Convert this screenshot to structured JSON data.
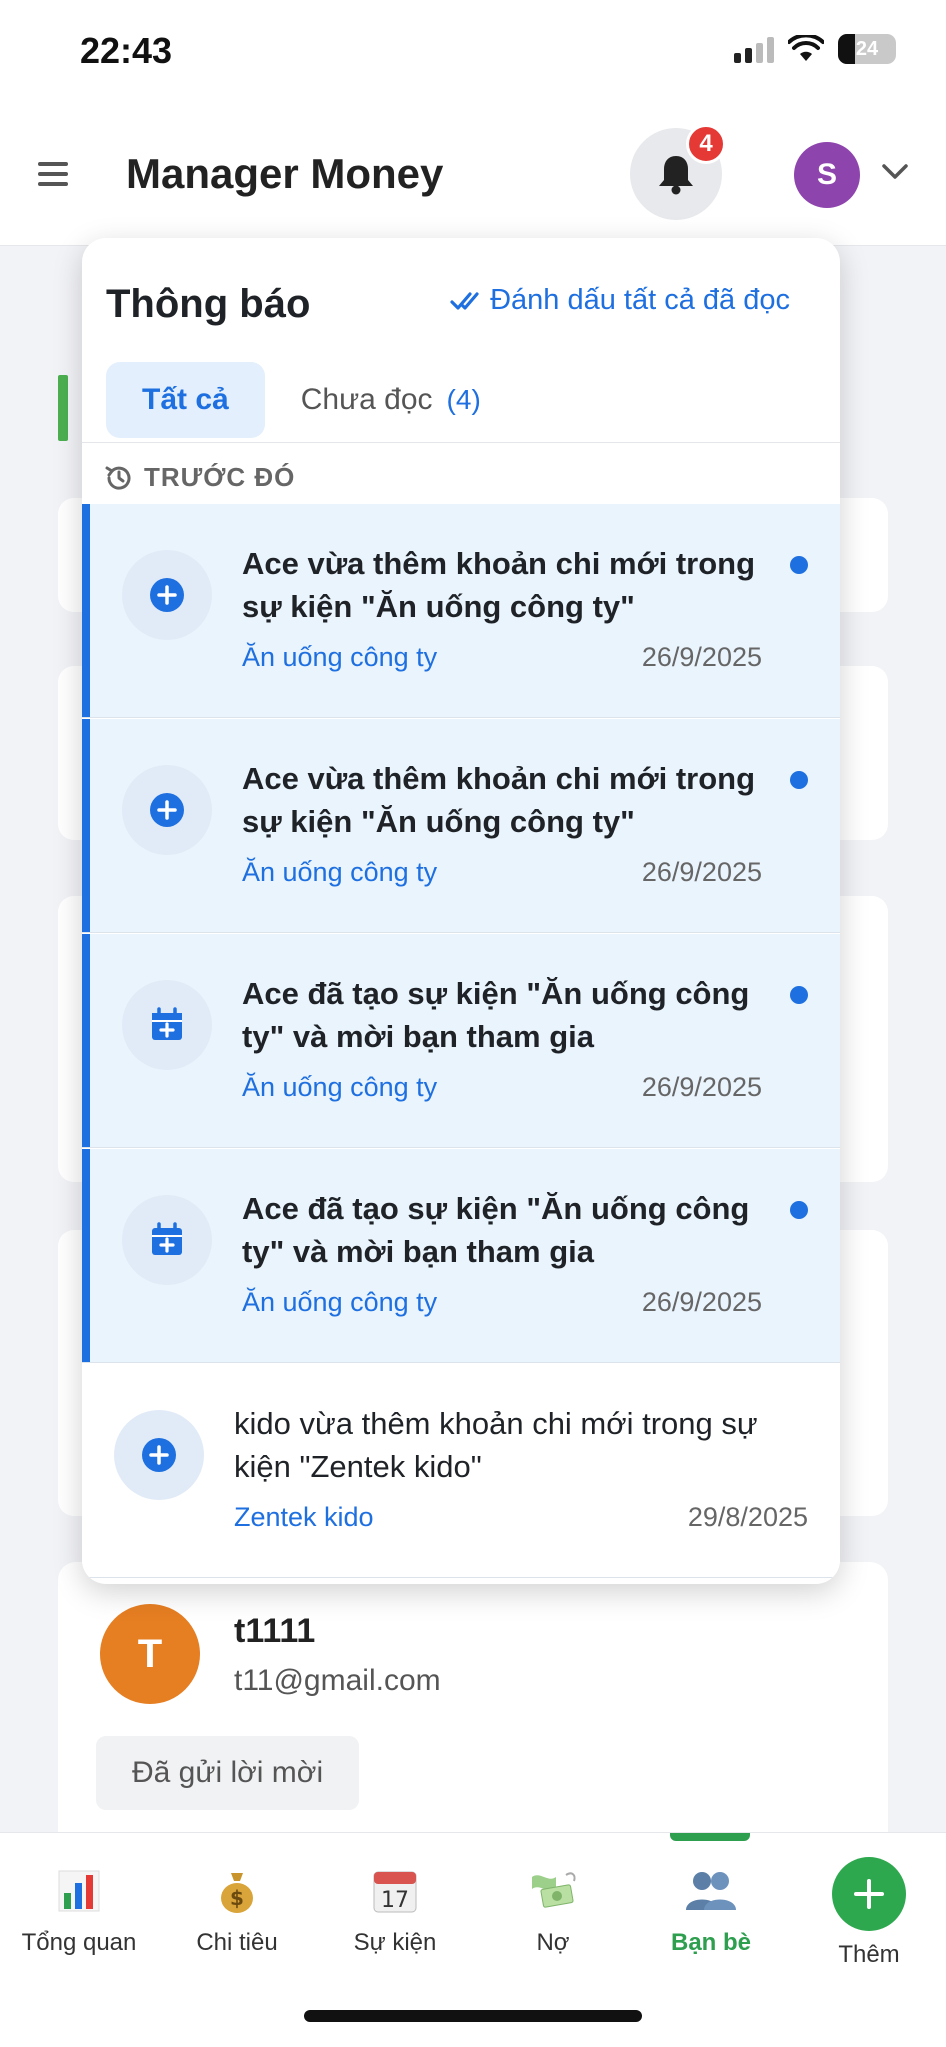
{
  "status_bar": {
    "time": "22:43",
    "battery": "24"
  },
  "header": {
    "title": "Manager Money",
    "notification_count": "4",
    "avatar_initial": "S"
  },
  "notifications_panel": {
    "title": "Thông báo",
    "mark_all_read": "Đánh dấu tất cả đã đọc",
    "tabs": {
      "all": "Tất cả",
      "unread": "Chưa đọc",
      "unread_count": "(4)"
    },
    "section_label": "TRƯỚC ĐÓ",
    "items": [
      {
        "text": "Ace vừa thêm khoản chi mới trong sự kiện \"Ăn uống công ty\"",
        "event": "Ăn uống công ty",
        "date": "26/9/2025",
        "icon": "plus-circle-icon",
        "unread": true
      },
      {
        "text": "Ace vừa thêm khoản chi mới trong sự kiện \"Ăn uống công ty\"",
        "event": "Ăn uống công ty",
        "date": "26/9/2025",
        "icon": "plus-circle-icon",
        "unread": true
      },
      {
        "text": "Ace đã tạo sự kiện \"Ăn uống công ty\" và mời bạn tham gia",
        "event": "Ăn uống công ty",
        "date": "26/9/2025",
        "icon": "calendar-plus-icon",
        "unread": true
      },
      {
        "text": "Ace đã tạo sự kiện \"Ăn uống công ty\" và mời bạn tham gia",
        "event": "Ăn uống công ty",
        "date": "26/9/2025",
        "icon": "calendar-plus-icon",
        "unread": true
      },
      {
        "text": "kido vừa thêm khoản chi mới trong sự kiện \"Zentek kido\"",
        "event": "Zentek kido",
        "date": "29/8/2025",
        "icon": "plus-circle-icon",
        "unread": false
      }
    ]
  },
  "friend_card": {
    "initial": "T",
    "name": "t1111",
    "email": "t11@gmail.com",
    "status_button": "Đã gửi lời mời"
  },
  "bottom_nav": {
    "items": [
      {
        "label": "Tổng quan",
        "icon": "bar-chart-icon"
      },
      {
        "label": "Chi tiêu",
        "icon": "money-bag-icon"
      },
      {
        "label": "Sự kiện",
        "icon": "calendar-icon"
      },
      {
        "label": "Nợ",
        "icon": "flying-money-icon"
      },
      {
        "label": "Bạn bè",
        "icon": "friends-icon",
        "active": true
      },
      {
        "label": "Thêm",
        "icon": "add-icon"
      }
    ]
  },
  "colors": {
    "accent": "#1e6fe0",
    "active_nav": "#2e9e4f",
    "badge": "#e53935",
    "unread_bg": "#eaf4fd"
  }
}
